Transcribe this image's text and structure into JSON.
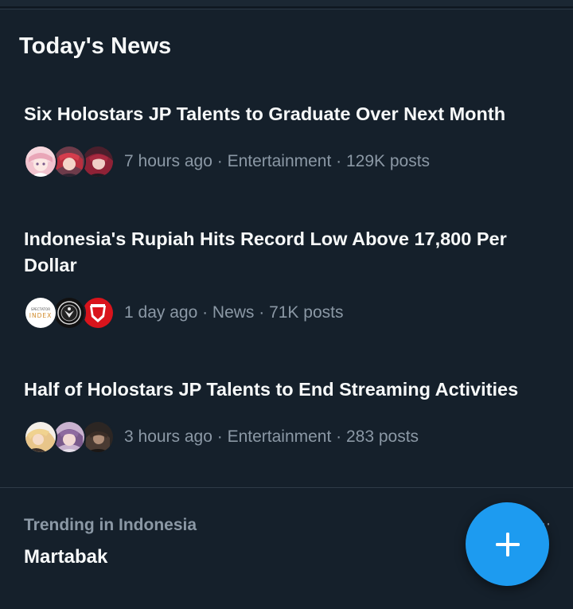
{
  "section": {
    "title": "Today's News"
  },
  "news": [
    {
      "headline": "Six Holostars JP Talents to Graduate Over Next Month",
      "meta": "7 hours ago · Entertainment · 129K posts",
      "avatars": [
        "anime-avatar-pink",
        "anime-avatar-red",
        "anime-avatar-crimson"
      ]
    },
    {
      "headline": "Indonesia's Rupiah Hits Record Low Above 17,800 Per Dollar",
      "meta": "1 day ago · News · 71K posts",
      "avatars": [
        "spectator-index-logo",
        "emblem-logo-black",
        "red-shield-logo"
      ],
      "logo_text": {
        "spectator_small": "SPECTATOR",
        "spectator_big": "INDEX"
      }
    },
    {
      "headline": "Half of Holostars JP Talents to End Streaming Activities",
      "meta": "3 hours ago · Entertainment · 283 posts",
      "avatars": [
        "anime-avatar-blonde",
        "anime-avatar-purple",
        "anime-avatar-dark"
      ]
    }
  ],
  "trend": {
    "context": "Trending in Indonesia",
    "name": "Martabak",
    "more_icon": "more-dots-icon"
  },
  "fab": {
    "icon": "plus-icon",
    "color": "#1d9bf0"
  },
  "colors": {
    "background": "#15202b",
    "text_primary": "#f7f9f9",
    "text_secondary": "#8b98a5",
    "accent": "#1d9bf0"
  }
}
